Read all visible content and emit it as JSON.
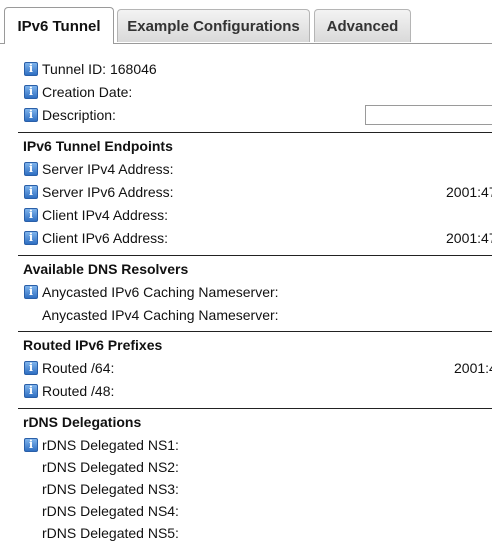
{
  "tabs": [
    {
      "label": "IPv6 Tunnel",
      "active": true
    },
    {
      "label": "Example Configurations",
      "active": false
    },
    {
      "label": "Advanced",
      "active": false
    }
  ],
  "tunnel": {
    "id_label": "Tunnel ID:",
    "id_value": "168046",
    "creation_date_label": "Creation Date:",
    "description_label": "Description:",
    "description_value": ""
  },
  "endpoints": {
    "title": "IPv6 Tunnel Endpoints",
    "server_ipv4_label": "Server IPv4 Address:",
    "server_ipv6_label": "Server IPv6 Address:",
    "server_ipv6_value": "2001:47",
    "client_ipv4_label": "Client IPv4 Address:",
    "client_ipv6_label": "Client IPv6 Address:",
    "client_ipv6_value": "2001:47"
  },
  "dns": {
    "title": "Available DNS Resolvers",
    "anycast_v6_label": "Anycasted IPv6 Caching Nameserver:",
    "anycast_v4_label": "Anycasted IPv4 Caching Nameserver:"
  },
  "prefixes": {
    "title": "Routed IPv6 Prefixes",
    "routed64_label": "Routed /64:",
    "routed64_value": "2001:4",
    "routed48_label": "Routed /48:"
  },
  "rdns": {
    "title": "rDNS Delegations",
    "ns": [
      "rDNS Delegated NS1:",
      "rDNS Delegated NS2:",
      "rDNS Delegated NS3:",
      "rDNS Delegated NS4:",
      "rDNS Delegated NS5:"
    ]
  },
  "icons": {
    "info": "info-icon"
  },
  "colors": {
    "info_icon": "#3b7dd8",
    "divider": "#222222",
    "tab_border": "#9a9a9a"
  }
}
